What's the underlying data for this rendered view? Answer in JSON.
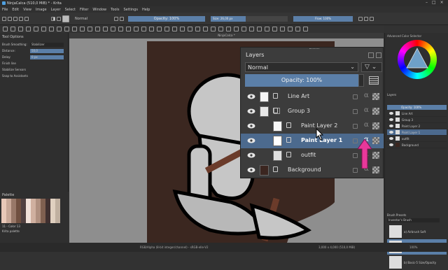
{
  "window": {
    "title": "NinjaCalca (510,0 MiB) * - Krita"
  },
  "menu": [
    "File",
    "Edit",
    "View",
    "Image",
    "Layer",
    "Select",
    "Filter",
    "Window",
    "Tools",
    "Settings",
    "Help"
  ],
  "toolbar": {
    "blend_mode": "Normal",
    "opacity_label": "Opacity: 100%",
    "size_label": "Size: 26,00 px",
    "flow_label": "Flow: 100%"
  },
  "document_tab": "NinjaCalca *",
  "tool_options": {
    "title": "Tool Options",
    "items": [
      {
        "label": "Brush Smoothing:",
        "value": "Stabilizer"
      },
      {
        "label": "Distance:",
        "value": "50,0"
      },
      {
        "label": "Delay:",
        "value": "0 px"
      },
      {
        "label": "Finish line",
        "value": ""
      },
      {
        "label": "Stabilize Sensors",
        "value": ""
      },
      {
        "label": "Snap to Assistants",
        "value": ""
      }
    ]
  },
  "palette": {
    "title": "Palette",
    "footer": "11 - Color 13",
    "footer2": "Krita palette"
  },
  "layers": {
    "title": "Layers",
    "blend_mode": "Normal",
    "opacity_label": "Opacity:  100%",
    "items": [
      {
        "label": "Line Art",
        "thumb": "#f4f4f4"
      },
      {
        "label": "Group 3",
        "thumb": "#e8e8e8"
      },
      {
        "label": "Paint Layer 2",
        "thumb": "#f8f8f8"
      },
      {
        "label": "Paint Layer 1",
        "thumb": "#ffffff"
      },
      {
        "label": "outfit",
        "thumb": "#e0e0e0"
      },
      {
        "label": "Background",
        "thumb": "#3b2620"
      }
    ]
  },
  "right_dock": {
    "color_title": "Advanced Color Selector",
    "layers_title": "Layers",
    "opacity_label": "Opacity: 100%",
    "layers": [
      "Line Art",
      "Group 3",
      "Paint Layer 2",
      "Paint Layer 1",
      "outfit",
      "Background"
    ],
    "presets_title": "Brush Presets",
    "preset_filter": "Inventor's Brush",
    "presets": [
      "a) Airbrush Soft",
      "b) Basic-1",
      "b) Basic-5 Size/Opacity"
    ]
  },
  "status": {
    "left": "RGB/Alpha (8-bit integer/channel) - sRGB-elle-V2",
    "right": "3,000 x 4,000 (510,0 MiB)",
    "zoom": "100%"
  },
  "colors": {
    "accent": "#5b7fa8",
    "canvas_bg": "#3b2720",
    "pink_arrow": "#e8389a"
  }
}
